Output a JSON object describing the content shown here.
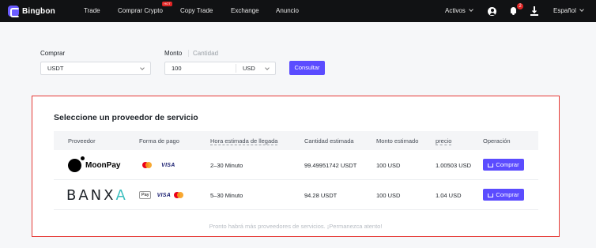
{
  "brand": {
    "name": "Bingbon"
  },
  "nav": {
    "items": [
      "Trade",
      "Comprar Crypto",
      "Copy Trade",
      "Exchange",
      "Anuncio"
    ],
    "hot_badge": "HOT",
    "assets": "Activos",
    "notif_count": "2",
    "language": "Español"
  },
  "form": {
    "buy_label": "Comprar",
    "buy_value": "USDT",
    "amount_label": "Monto",
    "quantity_label": "Cantidad",
    "amount_value": "100",
    "currency_value": "USD",
    "consult_button": "Consultar"
  },
  "providers": {
    "title": "Seleccione un proveedor de servicio",
    "columns": [
      "Proveedor",
      "Forma de pago",
      "Hora estimada de llegada",
      "Cantidad estimada",
      "Monto estimado",
      "precio",
      "Operación"
    ],
    "rows": [
      {
        "provider": "MoonPay",
        "payments": [
          "mastercard",
          "VISA"
        ],
        "eta": "2–30 Minuto",
        "quantity": "99.49951742 USDT",
        "amount": "100 USD",
        "price": "1.00503 USD",
        "action": "Comprar"
      },
      {
        "provider": "BANXA",
        "payments": [
          "Pay",
          "VISA",
          "mastercard"
        ],
        "eta": "5–30 Minuto",
        "quantity": "94.28 USDT",
        "amount": "100 USD",
        "price": "1.04 USD",
        "action": "Comprar"
      }
    ],
    "footer_note": "Pronto habrá más proveedores de servicios. ¡Permanezca atento!"
  },
  "colors": {
    "accent": "#5b4cff",
    "highlight_border": "#e53935",
    "topbar": "#111214"
  },
  "icons": [
    "logo-icon",
    "user-icon",
    "bell-icon",
    "download-icon",
    "chevron-down-icon",
    "cart-icon",
    "mastercard-icon",
    "visa-icon",
    "applepay-icon"
  ]
}
